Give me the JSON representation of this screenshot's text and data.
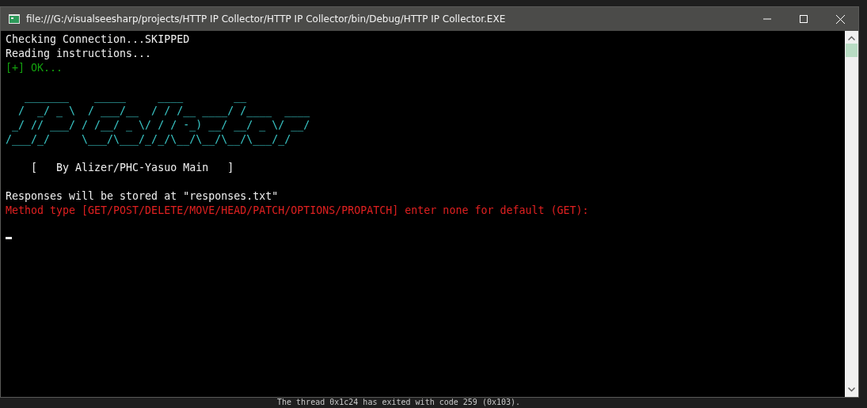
{
  "window": {
    "title": "file:///G:/visualseesharp/projects/HTTP IP Collector/HTTP IP Collector/bin/Debug/HTTP IP Collector.EXE"
  },
  "console": {
    "groups": [
      {
        "lines": [
          {
            "text": "Checking Connection...SKIPPED",
            "kind": "normal"
          },
          {
            "text": "Reading instructions...",
            "kind": "normal"
          },
          {
            "text": "[+] OK...",
            "kind": "success"
          }
        ]
      },
      {
        "lines": [
          {
            "text": "   _______    _____     ____        __",
            "kind": "banner"
          },
          {
            "text": "  /  _/ _ \\  / ___/__  / / /__ ____/ /____  ____",
            "kind": "banner"
          },
          {
            "text": " _/ // ___/ / /__/ _ \\/ / / -_) __/ __/ _ \\/ __/",
            "kind": "banner"
          },
          {
            "text": "/___/_/     \\___/\\___/_/_/\\__/\\__/\\__/\\___/_/",
            "kind": "banner"
          }
        ]
      },
      {
        "lines": [
          {
            "text": "    [   By Alizer/PHC-Yasuo Main   ]",
            "kind": "normal"
          }
        ]
      },
      {
        "lines": [
          {
            "text": "Responses will be stored at \"responses.txt\"",
            "kind": "normal"
          },
          {
            "text": "Method type [GET/POST/DELETE/MOVE/HEAD/PATCH/OPTIONS/PROPATCH] enter none for default (GET):",
            "kind": "error"
          }
        ]
      }
    ]
  },
  "ide_output": {
    "text": "The thread 0x1c24 has exited with code 259 (0x103)."
  }
}
